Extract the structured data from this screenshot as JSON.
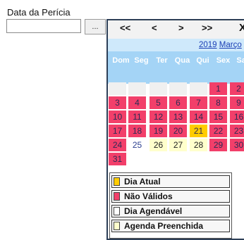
{
  "form": {
    "label": "Data da Perícia",
    "date_value": "",
    "open_button": "..."
  },
  "calendar": {
    "nav": {
      "prev_year": "<<",
      "prev_month": "<",
      "next_month": ">",
      "next_year": ">>",
      "close": "X"
    },
    "year": "2019",
    "month": "Março",
    "weekdays": [
      "Dom",
      "Seg",
      "Ter",
      "Qua",
      "Qui",
      "Sex",
      "Sab"
    ],
    "weeks": [
      [
        null,
        null,
        null,
        null,
        null,
        {
          "day": "1",
          "status": "invalid"
        },
        {
          "day": "2",
          "status": "invalid"
        }
      ],
      [
        {
          "day": "3",
          "status": "invalid"
        },
        {
          "day": "4",
          "status": "invalid"
        },
        {
          "day": "5",
          "status": "invalid"
        },
        {
          "day": "6",
          "status": "invalid"
        },
        {
          "day": "7",
          "status": "invalid"
        },
        {
          "day": "8",
          "status": "invalid"
        },
        {
          "day": "9",
          "status": "invalid"
        }
      ],
      [
        {
          "day": "10",
          "status": "invalid"
        },
        {
          "day": "11",
          "status": "invalid"
        },
        {
          "day": "12",
          "status": "invalid"
        },
        {
          "day": "13",
          "status": "invalid"
        },
        {
          "day": "14",
          "status": "invalid"
        },
        {
          "day": "15",
          "status": "invalid"
        },
        {
          "day": "16",
          "status": "invalid"
        }
      ],
      [
        {
          "day": "17",
          "status": "invalid"
        },
        {
          "day": "18",
          "status": "invalid"
        },
        {
          "day": "19",
          "status": "invalid"
        },
        {
          "day": "20",
          "status": "invalid"
        },
        {
          "day": "21",
          "status": "today"
        },
        {
          "day": "22",
          "status": "invalid"
        },
        {
          "day": "23",
          "status": "invalid"
        }
      ],
      [
        {
          "day": "24",
          "status": "invalid"
        },
        {
          "day": "25",
          "status": "available"
        },
        {
          "day": "26",
          "status": "full"
        },
        {
          "day": "27",
          "status": "full"
        },
        {
          "day": "28",
          "status": "full"
        },
        {
          "day": "29",
          "status": "invalid"
        },
        {
          "day": "30",
          "status": "invalid"
        }
      ],
      [
        {
          "day": "31",
          "status": "invalid"
        },
        null,
        null,
        null,
        null,
        null,
        null
      ]
    ],
    "legend": [
      {
        "label": "Dia Atual",
        "color": "#ffcc00"
      },
      {
        "label": "Não Válidos",
        "color": "#f23f6a"
      },
      {
        "label": "Dia Agendável",
        "color": "#ffffff"
      },
      {
        "label": "Agenda Preenchida",
        "color": "#ffffcc"
      }
    ]
  }
}
